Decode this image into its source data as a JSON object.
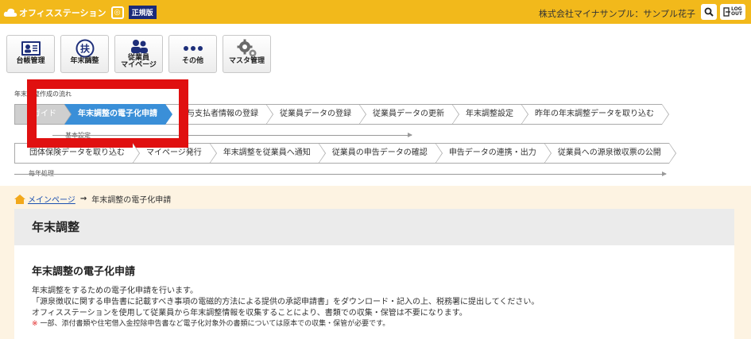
{
  "header": {
    "brand": "オフィスステーション",
    "edition": "正規版",
    "user": "株式会社マイナサンプル：サンプル花子",
    "logout_top": "LOG",
    "logout_bottom": "OUT"
  },
  "menu": [
    {
      "label": "台帳管理",
      "icon": "ledger-icon"
    },
    {
      "label": "年末調整",
      "icon": "fu-icon"
    },
    {
      "label1": "従業員",
      "label2": "マイページ",
      "icon": "employees-icon"
    },
    {
      "label": "その他",
      "icon": "dots-icon"
    },
    {
      "label": "マスタ管理",
      "icon": "gears-icon"
    }
  ],
  "flow": {
    "title": "年末調整作成の流れ",
    "row1": [
      "ガイド",
      "年末調整の電子化申請",
      "給与支払者情報の登録",
      "従業員データの登録",
      "従業員データの更新",
      "年末調整設定",
      "昨年の年末調整データを取り込む"
    ],
    "row1_caption": "基本設定",
    "row2": [
      "団体保険データを取り込む",
      "マイページ発行",
      "年末調整を従業員へ通知",
      "従業員の申告データの確認",
      "申告データの連携・出力",
      "従業員への源泉徴収票の公開"
    ],
    "row2_caption": "毎年処理"
  },
  "breadcrumb": {
    "home": "メインページ",
    "current": "年末調整の電子化申請"
  },
  "panel": {
    "title": "年末調整",
    "heading": "年末調整の電子化申請",
    "lines": [
      "年末調整をするための電子化申請を行います。",
      "「源泉徴収に関する申告書に記載すべき事項の電磁的方法による提供の承認申請書」をダウンロード・記入の上、税務署に提出してください。",
      "オフィスステーションを使用して従業員から年末調整情報を収集することにより、書類での収集・保管は不要になります。"
    ],
    "note_mark": "※",
    "note": "一部、添付書類や住宅借入金控除申告書など電子化対象外の書類については原本での収集・保管が必要です。"
  },
  "colors": {
    "topbar": "#f2b91b",
    "active_step": "#3a8fd8",
    "highlight": "#e01010",
    "background": "#fdf3e2"
  }
}
